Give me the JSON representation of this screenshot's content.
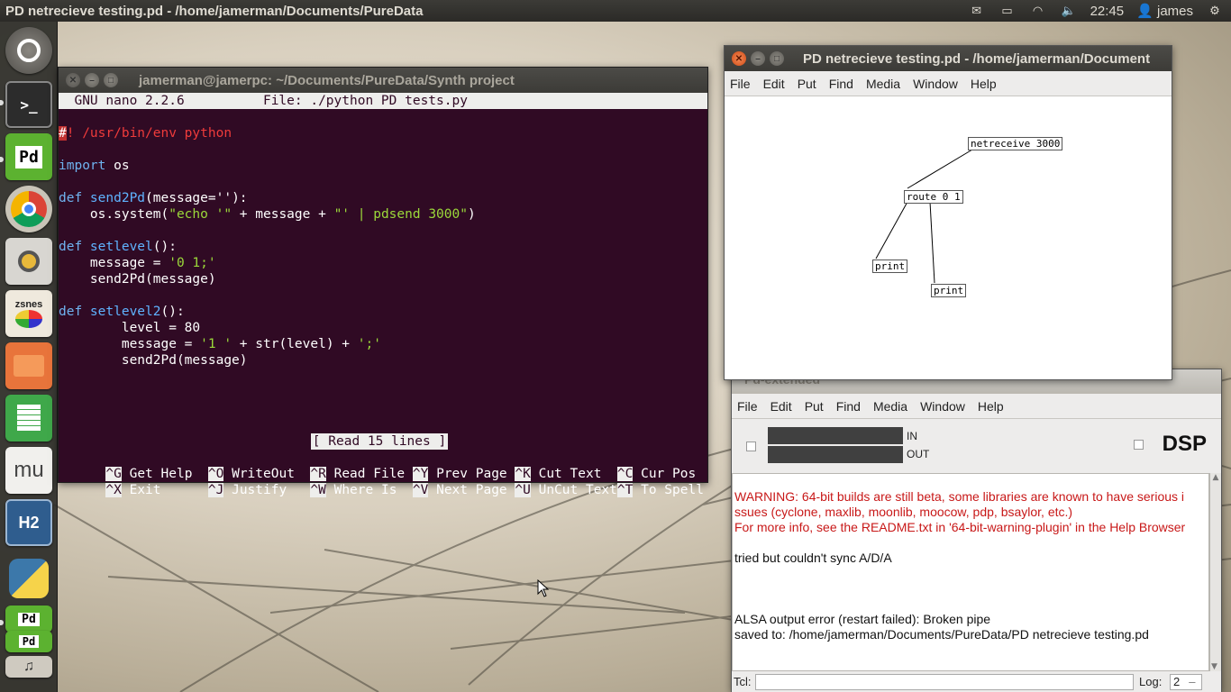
{
  "top_panel": {
    "title": "PD netrecieve testing.pd  - /home/jamerman/Documents/PureData",
    "clock": "22:45",
    "user": "james"
  },
  "launcher": {
    "items": [
      {
        "name": "ubuntu-dash",
        "label": ""
      },
      {
        "name": "terminal",
        "label": ">_"
      },
      {
        "name": "pd",
        "label": "Pd"
      },
      {
        "name": "chrome",
        "label": ""
      },
      {
        "name": "speaker-app",
        "label": ""
      },
      {
        "name": "zsnes",
        "label": "zsnes"
      },
      {
        "name": "files",
        "label": ""
      },
      {
        "name": "spreadsheet",
        "label": ""
      },
      {
        "name": "mu",
        "label": "mu"
      },
      {
        "name": "h2",
        "label": "H2"
      },
      {
        "name": "python",
        "label": ""
      },
      {
        "name": "pd-2",
        "label": "Pd"
      },
      {
        "name": "pd-3",
        "label": "Pd"
      }
    ]
  },
  "terminal": {
    "title": "jamerman@jamerpc: ~/Documents/PureData/Synth project",
    "nano_header": "  GNU nano 2.2.6          File: ./python PD tests.py",
    "code": {
      "shebang_hash": "#",
      "shebang_rest": "! /usr/bin/env python",
      "import_kw": "import",
      "import_mod": " os",
      "def1_kw": "def",
      "def1_name": " send2Pd",
      "def1_args": "(message=''):",
      "sys_pre": "    os.system(",
      "sys_str1": "\"echo '\"",
      "sys_mid": " + message + ",
      "sys_str2": "\"' | pdsend 3000\"",
      "sys_post": ")",
      "def2_kw": "def",
      "def2_name": " setlevel",
      "def2_args": "():",
      "msg1_pre": "    message = ",
      "msg1_str": "'0 1;'",
      "call1": "    send2Pd(message)",
      "def3_kw": "def",
      "def3_name": " setlevel2",
      "def3_args": "():",
      "level": "        level = 80",
      "msg2_pre": "        message = ",
      "msg2_str1": "'1 '",
      "msg2_mid": " + str(level) + ",
      "msg2_str2": "';'",
      "call2": "        send2Pd(message)"
    },
    "status": "[ Read 15 lines ]",
    "shortcuts_row1": [
      {
        "key": "^G",
        "label": " Get Help  "
      },
      {
        "key": "^O",
        "label": " WriteOut  "
      },
      {
        "key": "^R",
        "label": " Read File "
      },
      {
        "key": "^Y",
        "label": " Prev Page "
      },
      {
        "key": "^K",
        "label": " Cut Text  "
      },
      {
        "key": "^C",
        "label": " Cur Pos"
      }
    ],
    "shortcuts_row2": [
      {
        "key": "^X",
        "label": " Exit      "
      },
      {
        "key": "^J",
        "label": " Justify   "
      },
      {
        "key": "^W",
        "label": " Where Is  "
      },
      {
        "key": "^V",
        "label": " Next Page "
      },
      {
        "key": "^U",
        "label": " UnCut Text"
      },
      {
        "key": "^T",
        "label": " To Spell"
      }
    ]
  },
  "pd_patch": {
    "title": "PD netrecieve testing.pd  - /home/jamerman/Document",
    "menu": [
      "File",
      "Edit",
      "Put",
      "Find",
      "Media",
      "Window",
      "Help"
    ],
    "objects": {
      "netreceive": "netreceive 3000",
      "route": "route 0 1",
      "print1": "print",
      "print2": "print"
    }
  },
  "pd_main": {
    "title": "Pd-extended",
    "menu": [
      "File",
      "Edit",
      "Put",
      "Find",
      "Media",
      "Window",
      "Help"
    ],
    "in_label": "IN",
    "out_label": "OUT",
    "dsp_label": "DSP",
    "console": {
      "warn1": "WARNING: 64-bit builds are still beta, some libraries are known to have serious i",
      "warn2": "ssues (cyclone, maxlib, moonlib, moocow, pdp, bsaylor, etc.)",
      "warn3": "For more info, see the README.txt in '64-bit-warning-plugin' in the Help Browser",
      "line4": "tried but couldn't sync A/D/A",
      "line5": "ALSA output error (restart failed): Broken pipe",
      "line6": "saved to: /home/jamerman/Documents/PureData/PD netrecieve testing.pd"
    },
    "tcl_label": "Tcl:",
    "log_label": "Log:",
    "log_value": "2"
  }
}
